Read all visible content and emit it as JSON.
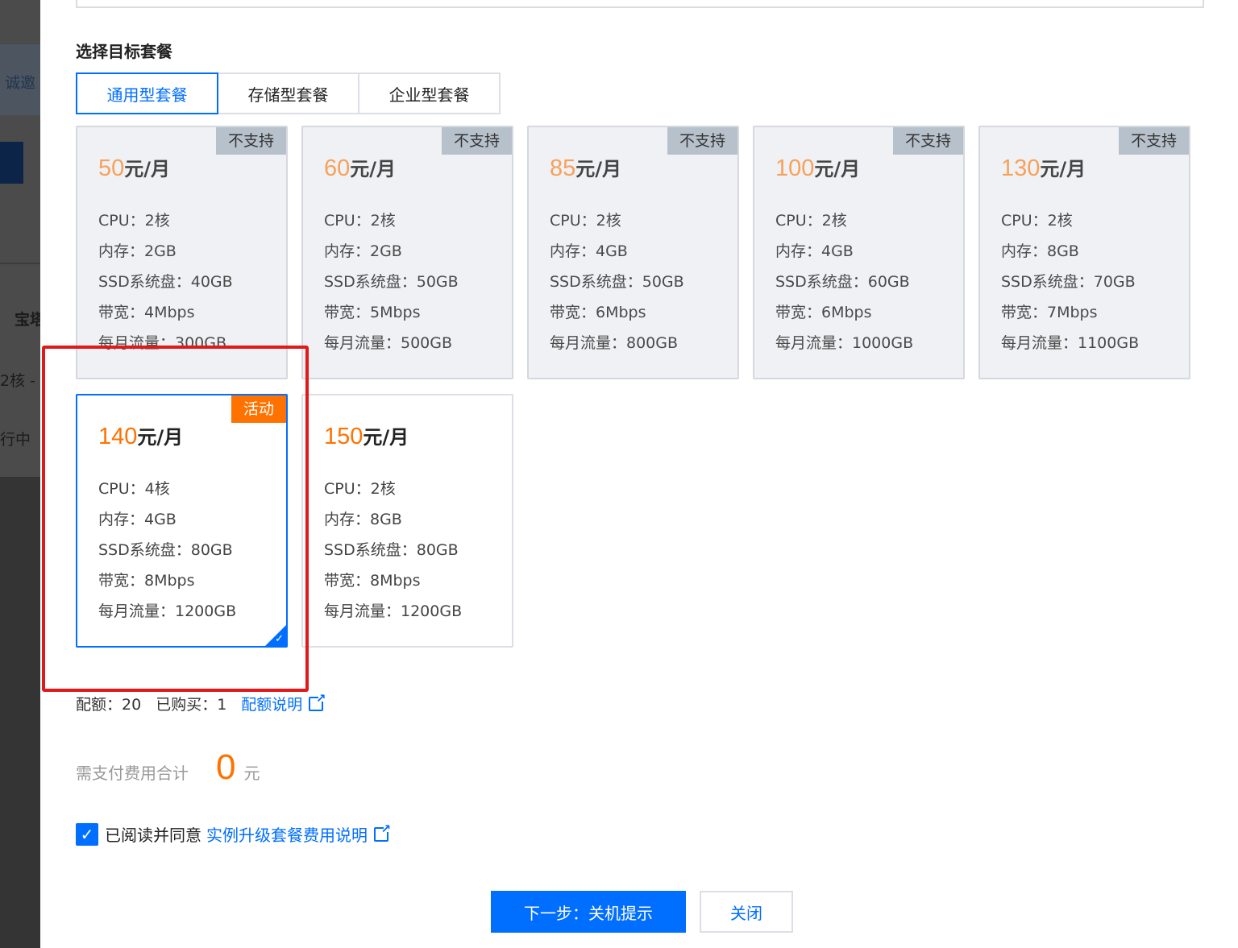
{
  "backdrop": {
    "texts": [
      "诚邀",
      "宝塔",
      "2核 -",
      "行中"
    ]
  },
  "section": {
    "title": "选择目标套餐"
  },
  "tabs": [
    {
      "label": "通用型套餐",
      "active": true
    },
    {
      "label": "存储型套餐",
      "active": false
    },
    {
      "label": "企业型套餐",
      "active": false
    }
  ],
  "plans": [
    {
      "price": "50",
      "unit": "元/月",
      "badge": "不支持",
      "state": "disabled",
      "specs": [
        "CPU：2核",
        "内存：2GB",
        "SSD系统盘：40GB",
        "带宽：4Mbps",
        "每月流量：300GB"
      ]
    },
    {
      "price": "60",
      "unit": "元/月",
      "badge": "不支持",
      "state": "disabled",
      "specs": [
        "CPU：2核",
        "内存：2GB",
        "SSD系统盘：50GB",
        "带宽：5Mbps",
        "每月流量：500GB"
      ]
    },
    {
      "price": "85",
      "unit": "元/月",
      "badge": "不支持",
      "state": "disabled",
      "specs": [
        "CPU：2核",
        "内存：4GB",
        "SSD系统盘：50GB",
        "带宽：6Mbps",
        "每月流量：800GB"
      ]
    },
    {
      "price": "100",
      "unit": "元/月",
      "badge": "不支持",
      "state": "disabled",
      "specs": [
        "CPU：2核",
        "内存：4GB",
        "SSD系统盘：60GB",
        "带宽：6Mbps",
        "每月流量：1000GB"
      ]
    },
    {
      "price": "130",
      "unit": "元/月",
      "badge": "不支持",
      "state": "disabled",
      "specs": [
        "CPU：2核",
        "内存：8GB",
        "SSD系统盘：70GB",
        "带宽：7Mbps",
        "每月流量：1100GB"
      ]
    },
    {
      "price": "140",
      "unit": "元/月",
      "badge": "活动",
      "state": "selected",
      "specs": [
        "CPU：4核",
        "内存：4GB",
        "SSD系统盘：80GB",
        "带宽：8Mbps",
        "每月流量：1200GB"
      ]
    },
    {
      "price": "150",
      "unit": "元/月",
      "badge": "",
      "state": "available",
      "specs": [
        "CPU：2核",
        "内存：8GB",
        "SSD系统盘：80GB",
        "带宽：8Mbps",
        "每月流量：1200GB"
      ]
    }
  ],
  "quota": {
    "quota_text": "配额：20",
    "purchased_text": "已购买：1",
    "link_label": "配额说明"
  },
  "total": {
    "label": "需支付费用合计",
    "amount": "0",
    "currency": "元"
  },
  "agreement": {
    "checked": true,
    "text": "已阅读并同意",
    "link_label": "实例升级套餐费用说明"
  },
  "buttons": {
    "next_label": "下一步：关机提示",
    "close_label": "关闭"
  },
  "colors": {
    "accent": "#006eff",
    "price": "#ff7200",
    "highlight": "#e0191b"
  }
}
